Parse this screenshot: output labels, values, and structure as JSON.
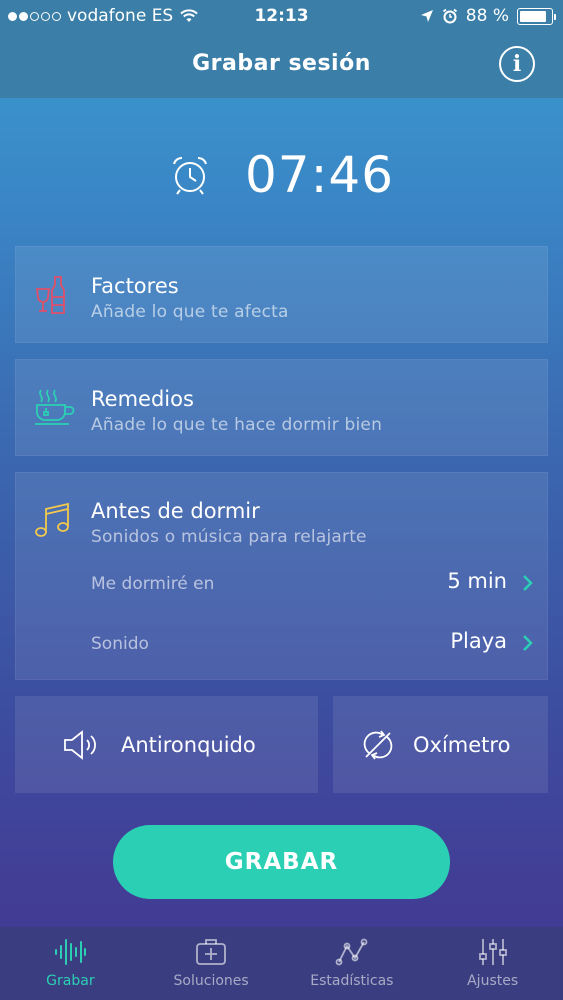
{
  "status_bar": {
    "carrier": "vodafone ES",
    "time": "12:13",
    "battery": "88 %",
    "battery_level": 0.88
  },
  "header": {
    "title": "Grabar sesión"
  },
  "alarm": {
    "time": "07:46"
  },
  "cards": {
    "factores": {
      "title": "Factores",
      "subtitle": "Añade lo que te afecta"
    },
    "remedios": {
      "title": "Remedios",
      "subtitle": "Añade lo que te hace dormir bien"
    },
    "antes": {
      "title": "Antes de dormir",
      "subtitle": "Sonidos o música para relajarte",
      "rows": [
        {
          "label": "Me dormiré en",
          "value": "5 min"
        },
        {
          "label": "Sonido",
          "value": "Playa"
        }
      ]
    }
  },
  "tools": {
    "antironquido": "Antironquido",
    "oximetro": "Oxímetro"
  },
  "record_button": "GRABAR",
  "tabs": [
    {
      "label": "Grabar",
      "active": true
    },
    {
      "label": "Soluciones",
      "active": false
    },
    {
      "label": "Estadísticas",
      "active": false
    },
    {
      "label": "Ajustes",
      "active": false
    }
  ],
  "colors": {
    "accent": "#2bd0b4",
    "factores_icon": "#e0506a",
    "remedios_icon": "#2bd0b4",
    "antes_icon": "#f2c94c"
  }
}
